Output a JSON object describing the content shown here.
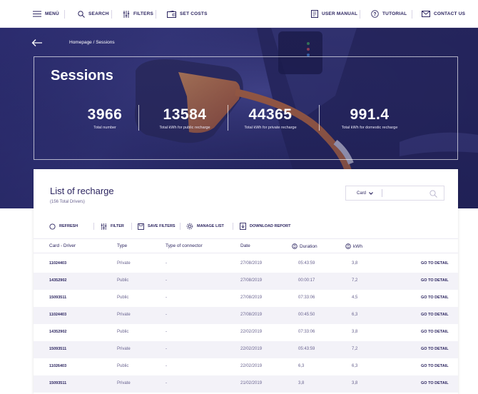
{
  "toolbar": {
    "menu": "MENÙ",
    "search": "SEARCH",
    "filters": "FILTERS",
    "set_costs": "SET COSTS",
    "user_manual": "USER MANUAL",
    "tutorial": "TUTORIAL",
    "contact_us": "CONTACT US"
  },
  "hero": {
    "breadcrumb": "Homepage / Sessions",
    "title": "Sessions",
    "stats": [
      {
        "value": "3966",
        "label": "Total number"
      },
      {
        "value": "13584",
        "label": "Total kWh for public recharge"
      },
      {
        "value": "44365",
        "label": "Total kWh for private recharge"
      },
      {
        "value": "991.4",
        "label": "Total kWh for domestic recharge"
      }
    ]
  },
  "list": {
    "title": "List of recharge",
    "subtitle": "(156 Total Drivers)",
    "search_select": "Card",
    "search_placeholder": "",
    "actions": {
      "refresh": "REFRESH",
      "filter": "FILTER",
      "save_filters": "SAVE FILTERS",
      "manage_list": "MANAGE LIST",
      "download_report": "DOWNLOAD REPORT"
    },
    "columns": {
      "card_driver": "Card - Driver",
      "type": "Type",
      "connector": "Type of connector",
      "date": "Date",
      "duration": "Duration",
      "kwh": "kWh"
    },
    "detail_label": "GO TO DETAIL",
    "rows": [
      {
        "card": "11024403",
        "type": "Private",
        "connector": "-",
        "date": "27/08/2019",
        "duration": "05:43:59",
        "kwh": "3,8"
      },
      {
        "card": "14352902",
        "type": "Public",
        "connector": "-",
        "date": "27/08/2019",
        "duration": "00:00:17",
        "kwh": "7,2"
      },
      {
        "card": "15093511",
        "type": "Public",
        "connector": "-",
        "date": "27/08/2019",
        "duration": "07:33:06",
        "kwh": "4,5"
      },
      {
        "card": "11024403",
        "type": "Private",
        "connector": "-",
        "date": "27/08/2019",
        "duration": "00:45:50",
        "kwh": "6,3"
      },
      {
        "card": "14352902",
        "type": "Public",
        "connector": "-",
        "date": "22/02/2019",
        "duration": "07:33:06",
        "kwh": "3,8"
      },
      {
        "card": "15093511",
        "type": "Private",
        "connector": "-",
        "date": "22/02/2019",
        "duration": "05:43:59",
        "kwh": "7,2"
      },
      {
        "card": "11026403",
        "type": "Public",
        "connector": "-",
        "date": "22/02/2019",
        "duration": "6,3",
        "kwh": "6,3"
      },
      {
        "card": "15093511",
        "type": "Private",
        "connector": "-",
        "date": "21/02/2019",
        "duration": "3,8",
        "kwh": "3,8"
      }
    ]
  },
  "colors": {
    "brand_navy": "#2c2560",
    "hero_bg": "#2d2f6e",
    "charger_orange": "#e07b2a",
    "row_alt": "#f3f2f8"
  }
}
